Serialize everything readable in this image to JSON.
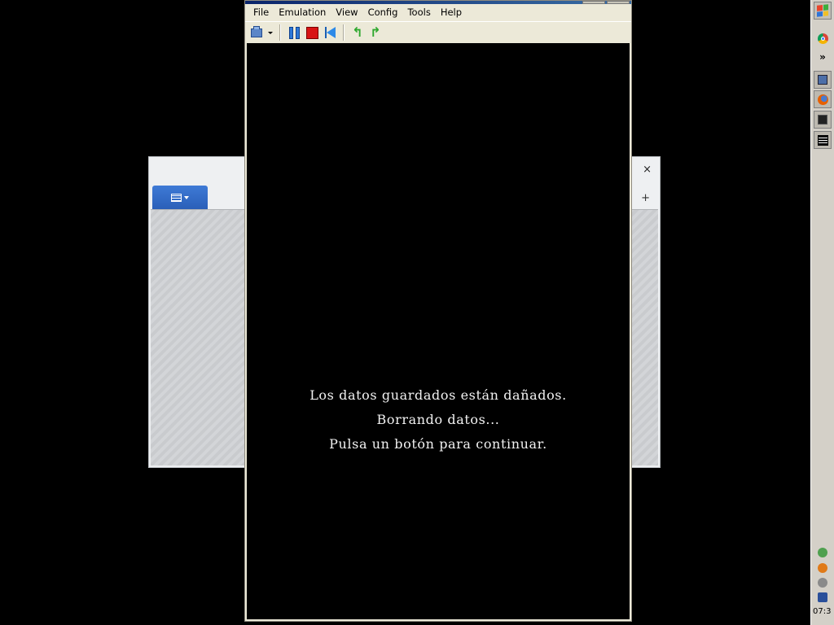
{
  "emulator": {
    "menu": [
      "File",
      "Emulation",
      "View",
      "Config",
      "Tools",
      "Help"
    ],
    "screen_message": [
      "Los datos guardados están dañados.",
      "Borrando datos...",
      "Pulsa un botón para continuar."
    ]
  },
  "background_window": {
    "close_glyph": "×",
    "add_glyph": "+"
  },
  "taskbar": {
    "overflow_glyph": "»",
    "clock": "07:3"
  },
  "colors": {
    "accent_tab": "#2a5fb8",
    "stop_red": "#d81414",
    "pause_blue": "#2d78d8"
  }
}
